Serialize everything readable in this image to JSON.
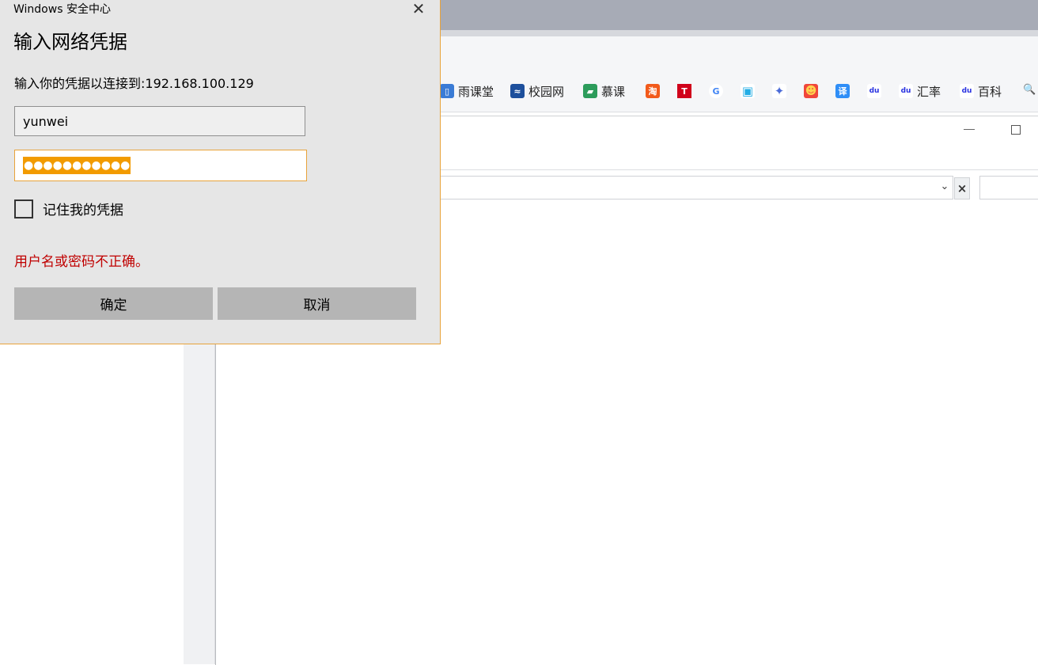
{
  "dialog": {
    "app_title": "Windows 安全中心",
    "close_glyph": "✕",
    "heading": "输入网络凭据",
    "subtitle": "输入你的凭据以连接到:192.168.100.129",
    "username": "yunwei",
    "password_mask": "●●●●●●●●●●●",
    "remember_label": "记住我的凭据",
    "remember_checked": false,
    "error": "用户名或密码不正确。",
    "ok_label": "确定",
    "cancel_label": "取消",
    "accent_color": "#e8a33a",
    "error_color": "#c00000"
  },
  "browser": {
    "bookmarks": [
      {
        "label": "雨课堂",
        "icon": "book-icon"
      },
      {
        "label": "校园网",
        "icon": "campus-icon"
      },
      {
        "label": "慕课",
        "icon": "mooc-icon"
      },
      {
        "label": "",
        "icon": "taobao-icon",
        "glyph": "淘"
      },
      {
        "label": "",
        "icon": "t-icon",
        "glyph": "T"
      },
      {
        "label": "",
        "icon": "google-icon",
        "glyph": "G"
      },
      {
        "label": "",
        "icon": "bilibili-icon",
        "glyph": "▣"
      },
      {
        "label": "",
        "icon": "bird-icon",
        "glyph": "✦"
      },
      {
        "label": "",
        "icon": "cat-icon",
        "glyph": "☻"
      },
      {
        "label": "",
        "icon": "translate-icon",
        "glyph": "译"
      },
      {
        "label": "",
        "icon": "baidu-icon",
        "glyph": "du"
      },
      {
        "label": "汇率",
        "icon": "baidu-icon",
        "glyph": "du"
      },
      {
        "label": "百科",
        "icon": "baidu-icon",
        "glyph": "du"
      }
    ],
    "window_controls": {
      "minimize": "—",
      "maximize": "□"
    },
    "combo_arrow": "⌄",
    "combo_clear": "×",
    "search_glyph": "🔍"
  }
}
